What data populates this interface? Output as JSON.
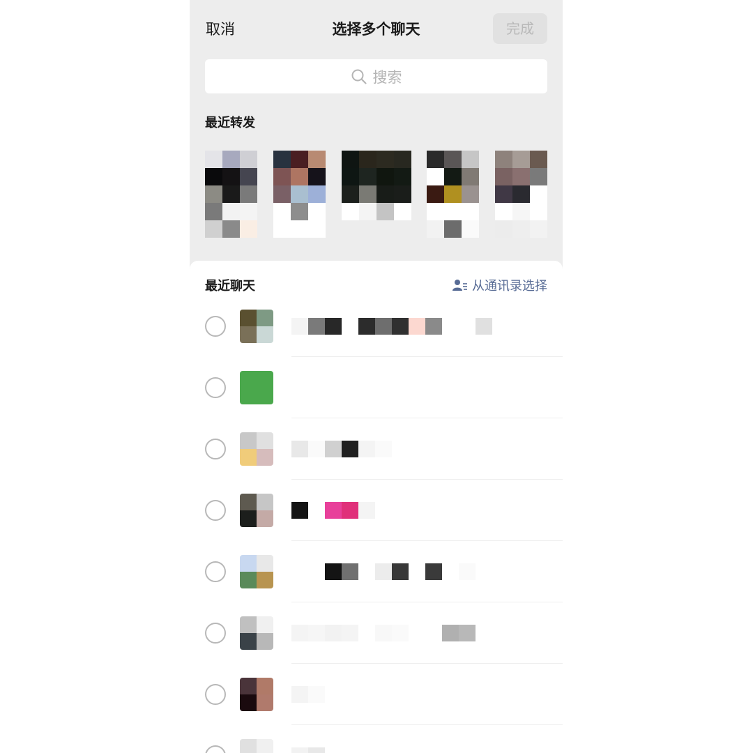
{
  "header": {
    "cancel_label": "取消",
    "title": "选择多个聊天",
    "done_label": "完成"
  },
  "search": {
    "placeholder": "搜索"
  },
  "recent_forward": {
    "title": "最近转发",
    "tiles": [
      {
        "cols": 3,
        "cells": [
          "#e4e4e8",
          "#a7a9be",
          "#cfcfd4",
          "#0a0a0c",
          "#141214",
          "#454550",
          "#8c8b84",
          "#1a1a1a",
          "#7a7a7a",
          "#7a7a7a",
          "#f2f2f2",
          "#f4f4f4",
          "#d0d0d0",
          "#8a8a8a",
          "#faeee4"
        ]
      },
      {
        "cols": 3,
        "cells": [
          "#28323f",
          "#4a1e22",
          "#b88a72",
          "#7e5454",
          "#ae7562",
          "#15121a",
          "#7a6066",
          "#a9bfd0",
          "#9db0d8",
          "#ffffff",
          "#8d8d8d",
          "#ffffff",
          "#ffffff",
          "#ffffff",
          "#ffffff"
        ]
      },
      {
        "cols": 4,
        "cells": [
          "#0f1512",
          "#2a261c",
          "#2c2a20",
          "#282820",
          "#0e1613",
          "#1e2520",
          "#10160f",
          "#131a14",
          "#1c201c",
          "#7a7a74",
          "#181c18",
          "#1a1d1a",
          "#ffffff",
          "#f4f4f4",
          "#c4c4c4",
          "#ffffff"
        ]
      },
      {
        "cols": 3,
        "cells": [
          "#2a2a2a",
          "#5a5656",
          "#c6c6c6",
          "#ffffff",
          "#131a14",
          "#807a74",
          "#3a1a12",
          "#b09020",
          "#9a9290",
          "#ffffff",
          "#ffffff",
          "#ffffff",
          "#f2f2f2",
          "#6c6c6c",
          "#fafafa"
        ]
      },
      {
        "cols": 3,
        "cells": [
          "#8e827c",
          "#a69c96",
          "#6a5a50",
          "#7a6262",
          "#8a7070",
          "#7a7a7a",
          "#403845",
          "#2a2a30",
          "#ffffff",
          "#ffffff",
          "#f6f6f6",
          "#ffffff",
          "#ececec",
          "#eeeeee",
          "#f2f2f2"
        ]
      }
    ]
  },
  "recent_chats": {
    "title": "最近聊天",
    "from_contacts_label": "从通讯录选择",
    "items": [
      {
        "avatar": [
          "#5a5030",
          "#7e9a84",
          "#7a7058",
          "#cad8d6"
        ],
        "name_blocks": [
          "#f4f4f4",
          "#7a7a7a",
          "#282828",
          "#ffffff",
          "#2c2c2c",
          "#6e6e6e",
          "#303030",
          "#fcd8d0",
          "#8a8a8a",
          "#ffffff",
          "#ffffff",
          "#e0e0e0"
        ]
      },
      {
        "avatar": [
          "#4aa84c",
          "#4aa84c",
          "#4aa84c",
          "#4aa84c"
        ],
        "name_blocks": []
      },
      {
        "avatar": [
          "#c8c8c8",
          "#e0e0e0",
          "#f0cc7a",
          "#d6bcbc"
        ],
        "name_blocks": [
          "#e8e8e8",
          "#fafafa",
          "#d0d0d0",
          "#202020",
          "#f4f4f4",
          "#fafafa"
        ]
      },
      {
        "avatar": [
          "#5e5a50",
          "#c6c6c6",
          "#1c1e1c",
          "#c4aaa6"
        ],
        "name_blocks": [
          "#141414",
          "#ffffff",
          "#e8409a",
          "#e0307a",
          "#f4f4f4"
        ]
      },
      {
        "avatar": [
          "#c8d8f0",
          "#e8e8e8",
          "#5a8a5a",
          "#b89450"
        ],
        "name_blocks": [
          "#ffffff",
          "#ffffff",
          "#141414",
          "#707070",
          "#ffffff",
          "#ececec",
          "#383838",
          "#ffffff",
          "#3a3a3a",
          "#ffffff",
          "#fafafa"
        ]
      },
      {
        "avatar": [
          "#c0c0c0",
          "#f0f0f0",
          "#3a4248",
          "#b8b8b8"
        ],
        "name_blocks": [
          "#f4f4f4",
          "#f6f6f6",
          "#f2f2f2",
          "#f4f4f4",
          "#ffffff",
          "#f8f8f8",
          "#fafafa",
          "#ffffff",
          "#ffffff",
          "#b0b0b0",
          "#b8b8b8"
        ]
      },
      {
        "avatar": [
          "#4a343a",
          "#b07a68",
          "#1a0a0e",
          "#b07a6c"
        ],
        "name_blocks": [
          "#f4f4f4",
          "#fafafa"
        ]
      },
      {
        "avatar": [
          "#e0e0e0",
          "#f0f0f0",
          "#ffffff",
          "#ffffff"
        ],
        "name_blocks": [
          "#f2f2f2",
          "#e8e8e8"
        ]
      }
    ]
  }
}
